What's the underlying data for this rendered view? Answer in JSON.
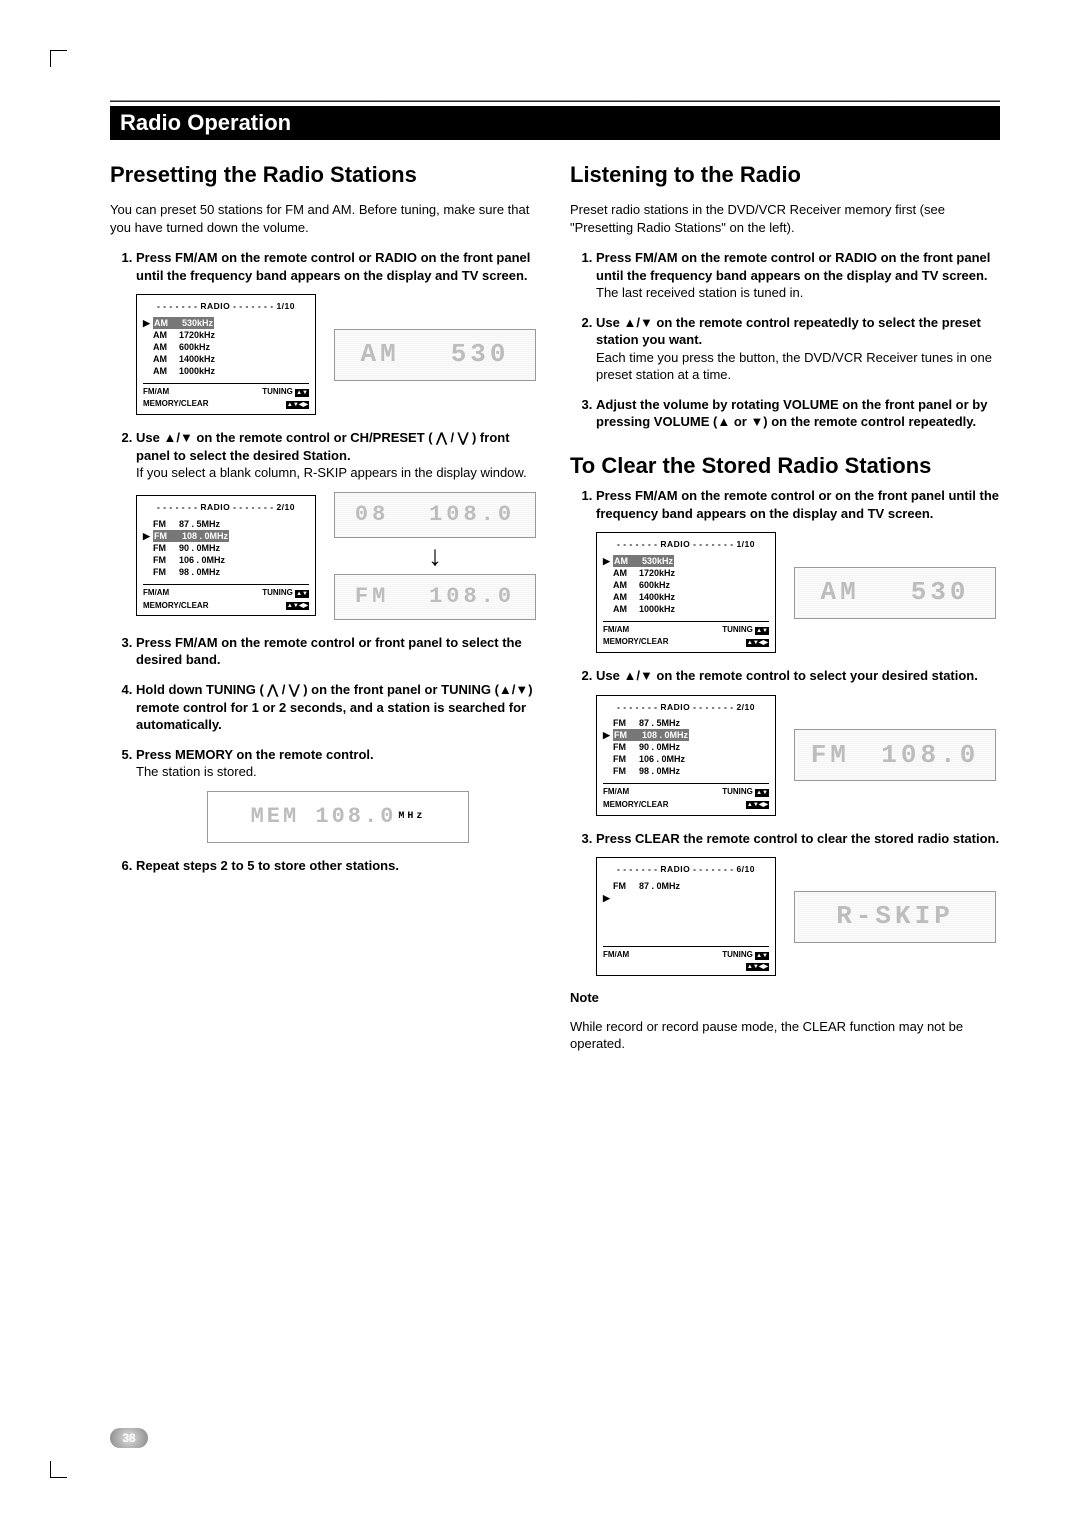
{
  "section_title": "Radio Operation",
  "page_number": "38",
  "left": {
    "heading": "Presetting the Radio Stations",
    "intro": "You can preset 50 stations for FM and AM. Before tuning, make sure that you have turned down the volume.",
    "step1": "Press FM/AM on the remote control or RADIO on the front panel until the frequency band appears on the display and TV screen.",
    "step2": "Use ▲/▼ on the remote control or CH/PRESET ( ⋀ / ⋁ )  front panel to select the desired Station.",
    "step2_sub": "If you select a blank column, R-SKIP appears in the display window.",
    "step3": "Press FM/AM on the remote control or front panel to select the desired band.",
    "step4": "Hold down TUNING ( ⋀ / ⋁ ) on the front panel or TUNING (▲/▼) remote control for 1 or 2 seconds, and a station is searched for automatically.",
    "step5": "Press MEMORY on the remote control.",
    "step5_sub": "The station is stored.",
    "step6": "Repeat steps 2 to 5 to store other stations.",
    "osd1": {
      "title": "- - - - - - - RADIO - - - - - - - 1/10",
      "rows": [
        {
          "ptr": "▶",
          "band": "AM",
          "freq": "530kHz",
          "hl": true
        },
        {
          "ptr": "",
          "band": "AM",
          "freq": "1720kHz"
        },
        {
          "ptr": "",
          "band": "AM",
          "freq": "600kHz"
        },
        {
          "ptr": "",
          "band": "AM",
          "freq": "1400kHz"
        },
        {
          "ptr": "",
          "band": "AM",
          "freq": "1000kHz"
        }
      ],
      "b1_left": "FM/AM",
      "b1_right": "TUNING",
      "b2_left": "MEMORY/CLEAR"
    },
    "osd2": {
      "title": "- - - - - - - RADIO - - - - - - - 2/10",
      "rows": [
        {
          "ptr": "",
          "band": "FM",
          "freq": "87 . 5MHz"
        },
        {
          "ptr": "▶",
          "band": "FM",
          "freq": "108 . 0MHz",
          "hl": true
        },
        {
          "ptr": "",
          "band": "FM",
          "freq": "90 . 0MHz"
        },
        {
          "ptr": "",
          "band": "FM",
          "freq": "106 . 0MHz"
        },
        {
          "ptr": "",
          "band": "FM",
          "freq": "98 . 0MHz"
        }
      ],
      "b1_left": "FM/AM",
      "b1_right": "TUNING",
      "b2_left": "MEMORY/CLEAR"
    },
    "lcd1_left": "AM",
    "lcd1_right": "530",
    "lcd2a_left": "08",
    "lcd2a_right": "108.0",
    "lcd2b_left": "FM",
    "lcd2b_right": "108.0",
    "mem_lcd": "MEM   108.0",
    "mem_unit": "MHz"
  },
  "right": {
    "heading1": "Listening to the Radio",
    "intro1": "Preset radio stations in the DVD/VCR Receiver memory first (see \"Presetting Radio Stations\" on the left).",
    "l_step1": "Press FM/AM on the remote control or RADIO on the front panel until the frequency band appears on the display and TV screen.",
    "l_step1_sub": "The last received station is tuned in.",
    "l_step2": "Use ▲/▼ on the remote control repeatedly to select the preset station you want.",
    "l_step2_sub": "Each time you press the button, the DVD/VCR Receiver tunes in one preset station at a time.",
    "l_step3": "Adjust the volume by rotating VOLUME on the front panel or by pressing VOLUME (▲ or ▼) on the remote control repeatedly.",
    "heading2": "To Clear the Stored Radio Stations",
    "c_step1": "Press FM/AM on the remote control or on the front panel until the frequency band appears on the display and TV screen.",
    "c_step2": "Use ▲/▼ on the remote control to select your desired station.",
    "c_step3": "Press CLEAR the remote control to clear the stored radio station.",
    "note_head": "Note",
    "note_body": "While record or record pause mode, the CLEAR function may not be operated.",
    "osdA": {
      "title": "- - - - - - - RADIO - - - - - - - 1/10",
      "rows": [
        {
          "ptr": "▶",
          "band": "AM",
          "freq": "530kHz",
          "hl": true
        },
        {
          "ptr": "",
          "band": "AM",
          "freq": "1720kHz"
        },
        {
          "ptr": "",
          "band": "AM",
          "freq": "600kHz"
        },
        {
          "ptr": "",
          "band": "AM",
          "freq": "1400kHz"
        },
        {
          "ptr": "",
          "band": "AM",
          "freq": "1000kHz"
        }
      ],
      "b1_left": "FM/AM",
      "b1_right": "TUNING",
      "b2_left": "MEMORY/CLEAR"
    },
    "osdB": {
      "title": "- - - - - - - RADIO - - - - - - - 2/10",
      "rows": [
        {
          "ptr": "",
          "band": "FM",
          "freq": "87 . 5MHz"
        },
        {
          "ptr": "▶",
          "band": "FM",
          "freq": "108 . 0MHz",
          "hl": true
        },
        {
          "ptr": "",
          "band": "FM",
          "freq": "90 . 0MHz"
        },
        {
          "ptr": "",
          "band": "FM",
          "freq": "106 . 0MHz"
        },
        {
          "ptr": "",
          "band": "FM",
          "freq": "98 . 0MHz"
        }
      ],
      "b1_left": "FM/AM",
      "b1_right": "TUNING",
      "b2_left": "MEMORY/CLEAR"
    },
    "osdC": {
      "title": "- - - - - - - RADIO - - - - - - - 6/10",
      "rows": [
        {
          "ptr": "",
          "band": "FM",
          "freq": "87 . 0MHz"
        },
        {
          "ptr": "▶",
          "band": "",
          "freq": "",
          "hl": true
        },
        {
          "ptr": "",
          "band": "",
          "freq": ""
        },
        {
          "ptr": "",
          "band": "",
          "freq": ""
        },
        {
          "ptr": "",
          "band": "",
          "freq": ""
        }
      ],
      "b1_left": "FM/AM",
      "b1_right": "TUNING",
      "b2_left": ""
    },
    "lcdA_left": "AM",
    "lcdA_right": "530",
    "lcdB_left": "FM",
    "lcdB_right": "108.0",
    "lcdC": "R-SKIP"
  }
}
